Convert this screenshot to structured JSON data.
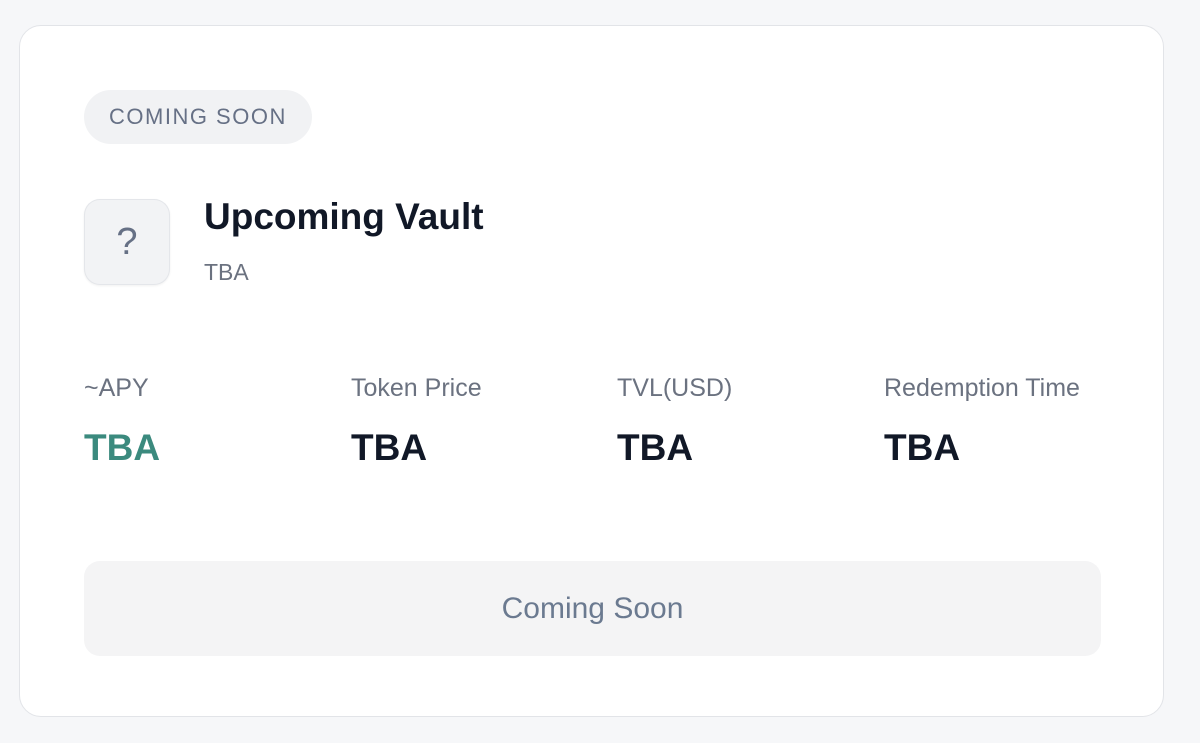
{
  "card": {
    "badge": "COMING SOON",
    "icon": {
      "name": "question-icon",
      "glyph": "?"
    },
    "title": "Upcoming Vault",
    "subtitle": "TBA",
    "stats": [
      {
        "label": "~APY",
        "value": "TBA",
        "color": "#3b8a7e"
      },
      {
        "label": "Token Price",
        "value": "TBA"
      },
      {
        "label": "TVL(USD)",
        "value": "TBA"
      },
      {
        "label": "Redemption Time",
        "value": "TBA"
      }
    ],
    "button_label": "Coming Soon"
  },
  "colors": {
    "accent": "#3b8a7e",
    "text_primary": "#111827",
    "text_secondary": "#6b7280"
  }
}
